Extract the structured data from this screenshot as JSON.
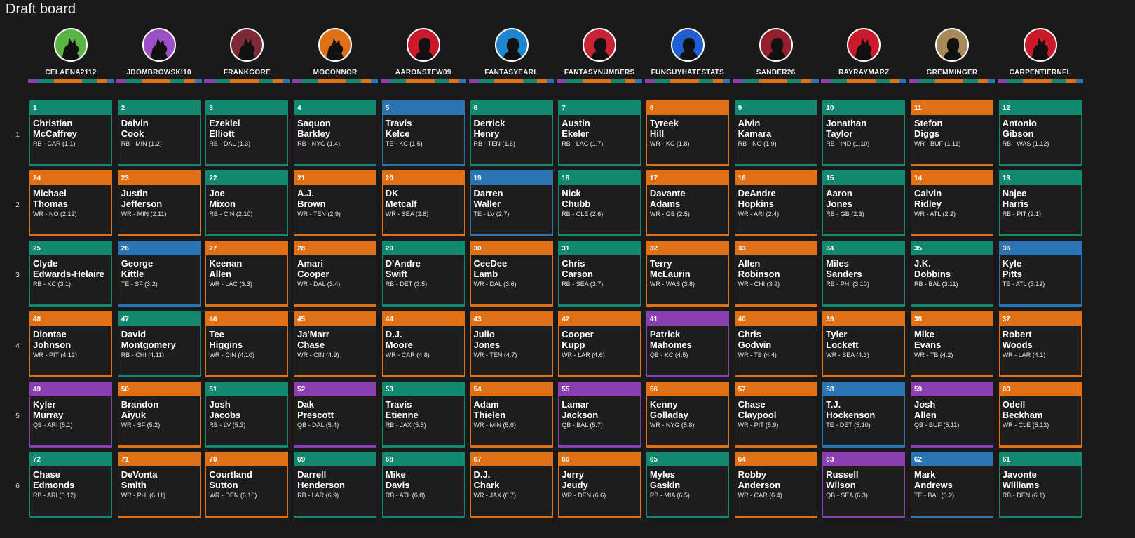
{
  "title": "Draft board",
  "position_colors": {
    "RB": "#12896f",
    "WR": "#e07016",
    "TE": "#2b74b3",
    "QB": "#8a3fb0"
  },
  "teams": [
    {
      "name": "CELAENA2112",
      "avatar_color": "#5ab443",
      "avatar_icon": "dog-silhouette-icon"
    },
    {
      "name": "JDOMBROWSKI10",
      "avatar_color": "#9c4fc6",
      "avatar_icon": "dog-silhouette-icon"
    },
    {
      "name": "FRANKGORE",
      "avatar_color": "#7e2a36",
      "avatar_icon": "dog-silhouette-icon"
    },
    {
      "name": "MOCONNOR",
      "avatar_color": "#e07016",
      "avatar_icon": "dog-silhouette-icon"
    },
    {
      "name": "AARONSTEW09",
      "avatar_color": "#c9192a",
      "avatar_icon": "person-silhouette-icon"
    },
    {
      "name": "FANTASYEARL",
      "avatar_color": "#1e86cf",
      "avatar_icon": "person-silhouette-icon"
    },
    {
      "name": "FANTASYNUMBERS",
      "avatar_color": "#c82433",
      "avatar_icon": "person-silhouette-icon"
    },
    {
      "name": "FUNGUYHATESTATS",
      "avatar_color": "#1f5fd1",
      "avatar_icon": "person-silhouette-icon"
    },
    {
      "name": "SANDER26",
      "avatar_color": "#94202e",
      "avatar_icon": "person-silhouette-icon"
    },
    {
      "name": "RAYRAYMARZ",
      "avatar_color": "#c9192a",
      "avatar_icon": "dog-silhouette-icon"
    },
    {
      "name": "GREMMINGER",
      "avatar_color": "#a88a5a",
      "avatar_icon": "person-silhouette-icon"
    },
    {
      "name": "CARPENTIERNFL",
      "avatar_color": "#c9192a",
      "avatar_icon": "dog-silhouette-icon"
    }
  ],
  "rounds": [
    {
      "round": "1",
      "picks": [
        {
          "no": "1",
          "first": "Christian",
          "last": "McCaffrey",
          "pos": "RB",
          "info": "RB - CAR (1.1)"
        },
        {
          "no": "2",
          "first": "Dalvin",
          "last": "Cook",
          "pos": "RB",
          "info": "RB - MIN (1.2)"
        },
        {
          "no": "3",
          "first": "Ezekiel",
          "last": "Elliott",
          "pos": "RB",
          "info": "RB - DAL (1.3)"
        },
        {
          "no": "4",
          "first": "Saquon",
          "last": "Barkley",
          "pos": "RB",
          "info": "RB - NYG (1.4)"
        },
        {
          "no": "5",
          "first": "Travis",
          "last": "Kelce",
          "pos": "TE",
          "info": "TE - KC (1.5)"
        },
        {
          "no": "6",
          "first": "Derrick",
          "last": "Henry",
          "pos": "RB",
          "info": "RB - TEN (1.6)"
        },
        {
          "no": "7",
          "first": "Austin",
          "last": "Ekeler",
          "pos": "RB",
          "info": "RB - LAC (1.7)"
        },
        {
          "no": "8",
          "first": "Tyreek",
          "last": "Hill",
          "pos": "WR",
          "info": "WR - KC (1.8)"
        },
        {
          "no": "9",
          "first": "Alvin",
          "last": "Kamara",
          "pos": "RB",
          "info": "RB - NO (1.9)"
        },
        {
          "no": "10",
          "first": "Jonathan",
          "last": "Taylor",
          "pos": "RB",
          "info": "RB - IND (1.10)"
        },
        {
          "no": "11",
          "first": "Stefon",
          "last": "Diggs",
          "pos": "WR",
          "info": "WR - BUF (1.11)"
        },
        {
          "no": "12",
          "first": "Antonio",
          "last": "Gibson",
          "pos": "RB",
          "info": "RB - WAS (1.12)"
        }
      ]
    },
    {
      "round": "2",
      "picks": [
        {
          "no": "24",
          "first": "Michael",
          "last": "Thomas",
          "pos": "WR",
          "info": "WR - NO (2.12)"
        },
        {
          "no": "23",
          "first": "Justin",
          "last": "Jefferson",
          "pos": "WR",
          "info": "WR - MIN (2.11)"
        },
        {
          "no": "22",
          "first": "Joe",
          "last": "Mixon",
          "pos": "RB",
          "info": "RB - CIN (2.10)"
        },
        {
          "no": "21",
          "first": "A.J.",
          "last": "Brown",
          "pos": "WR",
          "info": "WR - TEN (2.9)"
        },
        {
          "no": "20",
          "first": "DK",
          "last": "Metcalf",
          "pos": "WR",
          "info": "WR - SEA (2.8)"
        },
        {
          "no": "19",
          "first": "Darren",
          "last": "Waller",
          "pos": "TE",
          "info": "TE - LV (2.7)"
        },
        {
          "no": "18",
          "first": "Nick",
          "last": "Chubb",
          "pos": "RB",
          "info": "RB - CLE (2.6)"
        },
        {
          "no": "17",
          "first": "Davante",
          "last": "Adams",
          "pos": "WR",
          "info": "WR - GB (2.5)"
        },
        {
          "no": "16",
          "first": "DeAndre",
          "last": "Hopkins",
          "pos": "WR",
          "info": "WR - ARI (2.4)"
        },
        {
          "no": "15",
          "first": "Aaron",
          "last": "Jones",
          "pos": "RB",
          "info": "RB - GB (2.3)"
        },
        {
          "no": "14",
          "first": "Calvin",
          "last": "Ridley",
          "pos": "WR",
          "info": "WR - ATL (2.2)"
        },
        {
          "no": "13",
          "first": "Najee",
          "last": "Harris",
          "pos": "RB",
          "info": "RB - PIT (2.1)"
        }
      ]
    },
    {
      "round": "3",
      "picks": [
        {
          "no": "25",
          "first": "Clyde",
          "last": "Edwards-Helaire",
          "pos": "RB",
          "info": "RB - KC (3.1)"
        },
        {
          "no": "26",
          "first": "George",
          "last": "Kittle",
          "pos": "TE",
          "info": "TE - SF (3.2)"
        },
        {
          "no": "27",
          "first": "Keenan",
          "last": "Allen",
          "pos": "WR",
          "info": "WR - LAC (3.3)"
        },
        {
          "no": "28",
          "first": "Amari",
          "last": "Cooper",
          "pos": "WR",
          "info": "WR - DAL (3.4)"
        },
        {
          "no": "29",
          "first": "D'Andre",
          "last": "Swift",
          "pos": "RB",
          "info": "RB - DET (3.5)"
        },
        {
          "no": "30",
          "first": "CeeDee",
          "last": "Lamb",
          "pos": "WR",
          "info": "WR - DAL (3.6)"
        },
        {
          "no": "31",
          "first": "Chris",
          "last": "Carson",
          "pos": "RB",
          "info": "RB - SEA (3.7)"
        },
        {
          "no": "32",
          "first": "Terry",
          "last": "McLaurin",
          "pos": "WR",
          "info": "WR - WAS (3.8)"
        },
        {
          "no": "33",
          "first": "Allen",
          "last": "Robinson",
          "pos": "WR",
          "info": "WR - CHI (3.9)"
        },
        {
          "no": "34",
          "first": "Miles",
          "last": "Sanders",
          "pos": "RB",
          "info": "RB - PHI (3.10)"
        },
        {
          "no": "35",
          "first": "J.K.",
          "last": "Dobbins",
          "pos": "RB",
          "info": "RB - BAL (3.11)"
        },
        {
          "no": "36",
          "first": "Kyle",
          "last": "Pitts",
          "pos": "TE",
          "info": "TE - ATL (3.12)"
        }
      ]
    },
    {
      "round": "4",
      "picks": [
        {
          "no": "48",
          "first": "Diontae",
          "last": "Johnson",
          "pos": "WR",
          "info": "WR - PIT (4.12)"
        },
        {
          "no": "47",
          "first": "David",
          "last": "Montgomery",
          "pos": "RB",
          "info": "RB - CHI (4.11)"
        },
        {
          "no": "46",
          "first": "Tee",
          "last": "Higgins",
          "pos": "WR",
          "info": "WR - CIN (4.10)"
        },
        {
          "no": "45",
          "first": "Ja'Marr",
          "last": "Chase",
          "pos": "WR",
          "info": "WR - CIN (4.9)"
        },
        {
          "no": "44",
          "first": "D.J.",
          "last": "Moore",
          "pos": "WR",
          "info": "WR - CAR (4.8)"
        },
        {
          "no": "43",
          "first": "Julio",
          "last": "Jones",
          "pos": "WR",
          "info": "WR - TEN (4.7)"
        },
        {
          "no": "42",
          "first": "Cooper",
          "last": "Kupp",
          "pos": "WR",
          "info": "WR - LAR (4.6)"
        },
        {
          "no": "41",
          "first": "Patrick",
          "last": "Mahomes",
          "pos": "QB",
          "info": "QB - KC (4.5)"
        },
        {
          "no": "40",
          "first": "Chris",
          "last": "Godwin",
          "pos": "WR",
          "info": "WR - TB (4.4)"
        },
        {
          "no": "39",
          "first": "Tyler",
          "last": "Lockett",
          "pos": "WR",
          "info": "WR - SEA (4.3)"
        },
        {
          "no": "38",
          "first": "Mike",
          "last": "Evans",
          "pos": "WR",
          "info": "WR - TB (4.2)"
        },
        {
          "no": "37",
          "first": "Robert",
          "last": "Woods",
          "pos": "WR",
          "info": "WR - LAR (4.1)"
        }
      ]
    },
    {
      "round": "5",
      "picks": [
        {
          "no": "49",
          "first": "Kyler",
          "last": "Murray",
          "pos": "QB",
          "info": "QB - ARI (5.1)"
        },
        {
          "no": "50",
          "first": "Brandon",
          "last": "Aiyuk",
          "pos": "WR",
          "info": "WR - SF (5.2)"
        },
        {
          "no": "51",
          "first": "Josh",
          "last": "Jacobs",
          "pos": "RB",
          "info": "RB - LV (5.3)"
        },
        {
          "no": "52",
          "first": "Dak",
          "last": "Prescott",
          "pos": "QB",
          "info": "QB - DAL (5.4)"
        },
        {
          "no": "53",
          "first": "Travis",
          "last": "Etienne",
          "pos": "RB",
          "info": "RB - JAX (5.5)"
        },
        {
          "no": "54",
          "first": "Adam",
          "last": "Thielen",
          "pos": "WR",
          "info": "WR - MIN (5.6)"
        },
        {
          "no": "55",
          "first": "Lamar",
          "last": "Jackson",
          "pos": "QB",
          "info": "QB - BAL (5.7)"
        },
        {
          "no": "56",
          "first": "Kenny",
          "last": "Golladay",
          "pos": "WR",
          "info": "WR - NYG (5.8)"
        },
        {
          "no": "57",
          "first": "Chase",
          "last": "Claypool",
          "pos": "WR",
          "info": "WR - PIT (5.9)"
        },
        {
          "no": "58",
          "first": "T.J.",
          "last": "Hockenson",
          "pos": "TE",
          "info": "TE - DET (5.10)"
        },
        {
          "no": "59",
          "first": "Josh",
          "last": "Allen",
          "pos": "QB",
          "info": "QB - BUF (5.11)"
        },
        {
          "no": "60",
          "first": "Odell",
          "last": "Beckham",
          "pos": "WR",
          "info": "WR - CLE (5.12)"
        }
      ]
    },
    {
      "round": "6",
      "picks": [
        {
          "no": "72",
          "first": "Chase",
          "last": "Edmonds",
          "pos": "RB",
          "info": "RB - ARI (6.12)"
        },
        {
          "no": "71",
          "first": "DeVonta",
          "last": "Smith",
          "pos": "WR",
          "info": "WR - PHI (6.11)"
        },
        {
          "no": "70",
          "first": "Courtland",
          "last": "Sutton",
          "pos": "WR",
          "info": "WR - DEN (6.10)"
        },
        {
          "no": "69",
          "first": "Darrell",
          "last": "Henderson",
          "pos": "RB",
          "info": "RB - LAR (6.9)"
        },
        {
          "no": "68",
          "first": "Mike",
          "last": "Davis",
          "pos": "RB",
          "info": "RB - ATL (6.8)"
        },
        {
          "no": "67",
          "first": "D.J.",
          "last": "Chark",
          "pos": "WR",
          "info": "WR - JAX (6.7)"
        },
        {
          "no": "66",
          "first": "Jerry",
          "last": "Jeudy",
          "pos": "WR",
          "info": "WR - DEN (6.6)"
        },
        {
          "no": "65",
          "first": "Myles",
          "last": "Gaskin",
          "pos": "RB",
          "info": "RB - MIA (6.5)"
        },
        {
          "no": "64",
          "first": "Robby",
          "last": "Anderson",
          "pos": "WR",
          "info": "WR - CAR (6.4)"
        },
        {
          "no": "63",
          "first": "Russell",
          "last": "Wilson",
          "pos": "QB",
          "info": "QB - SEA (6.3)"
        },
        {
          "no": "62",
          "first": "Mark",
          "last": "Andrews",
          "pos": "TE",
          "info": "TE - BAL (6.2)"
        },
        {
          "no": "61",
          "first": "Javonte",
          "last": "Williams",
          "pos": "RB",
          "info": "RB - DEN (6.1)"
        }
      ]
    }
  ]
}
